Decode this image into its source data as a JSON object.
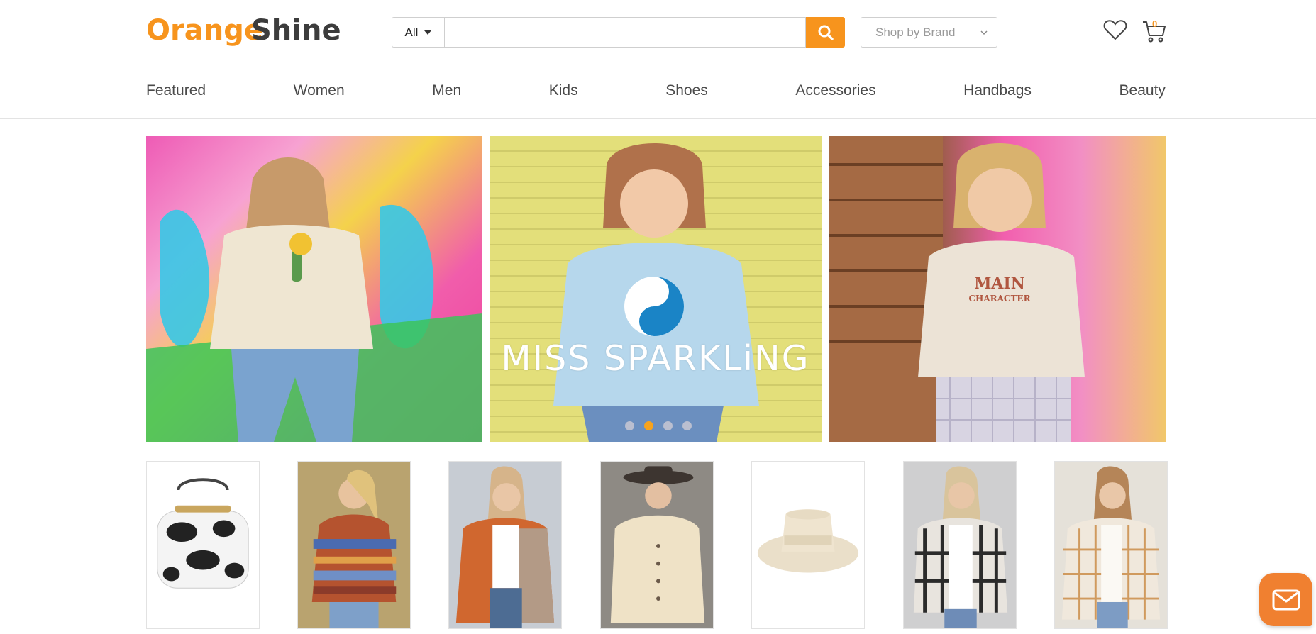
{
  "brand": {
    "logo_text_a": "Orange",
    "logo_text_b": "Shine",
    "accent_color": "#f7941d"
  },
  "search": {
    "category_value": "All",
    "query_value": "",
    "placeholder": ""
  },
  "brand_filter": {
    "selected": "Shop by Brand"
  },
  "cart": {
    "count": "0"
  },
  "icons": {
    "search": "search-icon",
    "wishlist": "heart-icon",
    "cart": "cart-icon",
    "chat": "envelope-icon"
  },
  "nav": {
    "items": [
      {
        "label": "Featured"
      },
      {
        "label": "Women"
      },
      {
        "label": "Men"
      },
      {
        "label": "Kids"
      },
      {
        "label": "Shoes"
      },
      {
        "label": "Accessories"
      },
      {
        "label": "Handbags"
      },
      {
        "label": "Beauty"
      }
    ]
  },
  "hero": {
    "slide_text": "MISS SPARKLiNG",
    "active_slide": 2,
    "slides_count": 4
  },
  "products": {
    "items": [
      {
        "kind": "cow print backpack"
      },
      {
        "kind": "aztec print shacket"
      },
      {
        "kind": "colorblock cardigan"
      },
      {
        "kind": "cream button jacket"
      },
      {
        "kind": "cream fedora hat"
      },
      {
        "kind": "plaid hooded shacket"
      },
      {
        "kind": "plaid flannel shirt"
      }
    ]
  }
}
